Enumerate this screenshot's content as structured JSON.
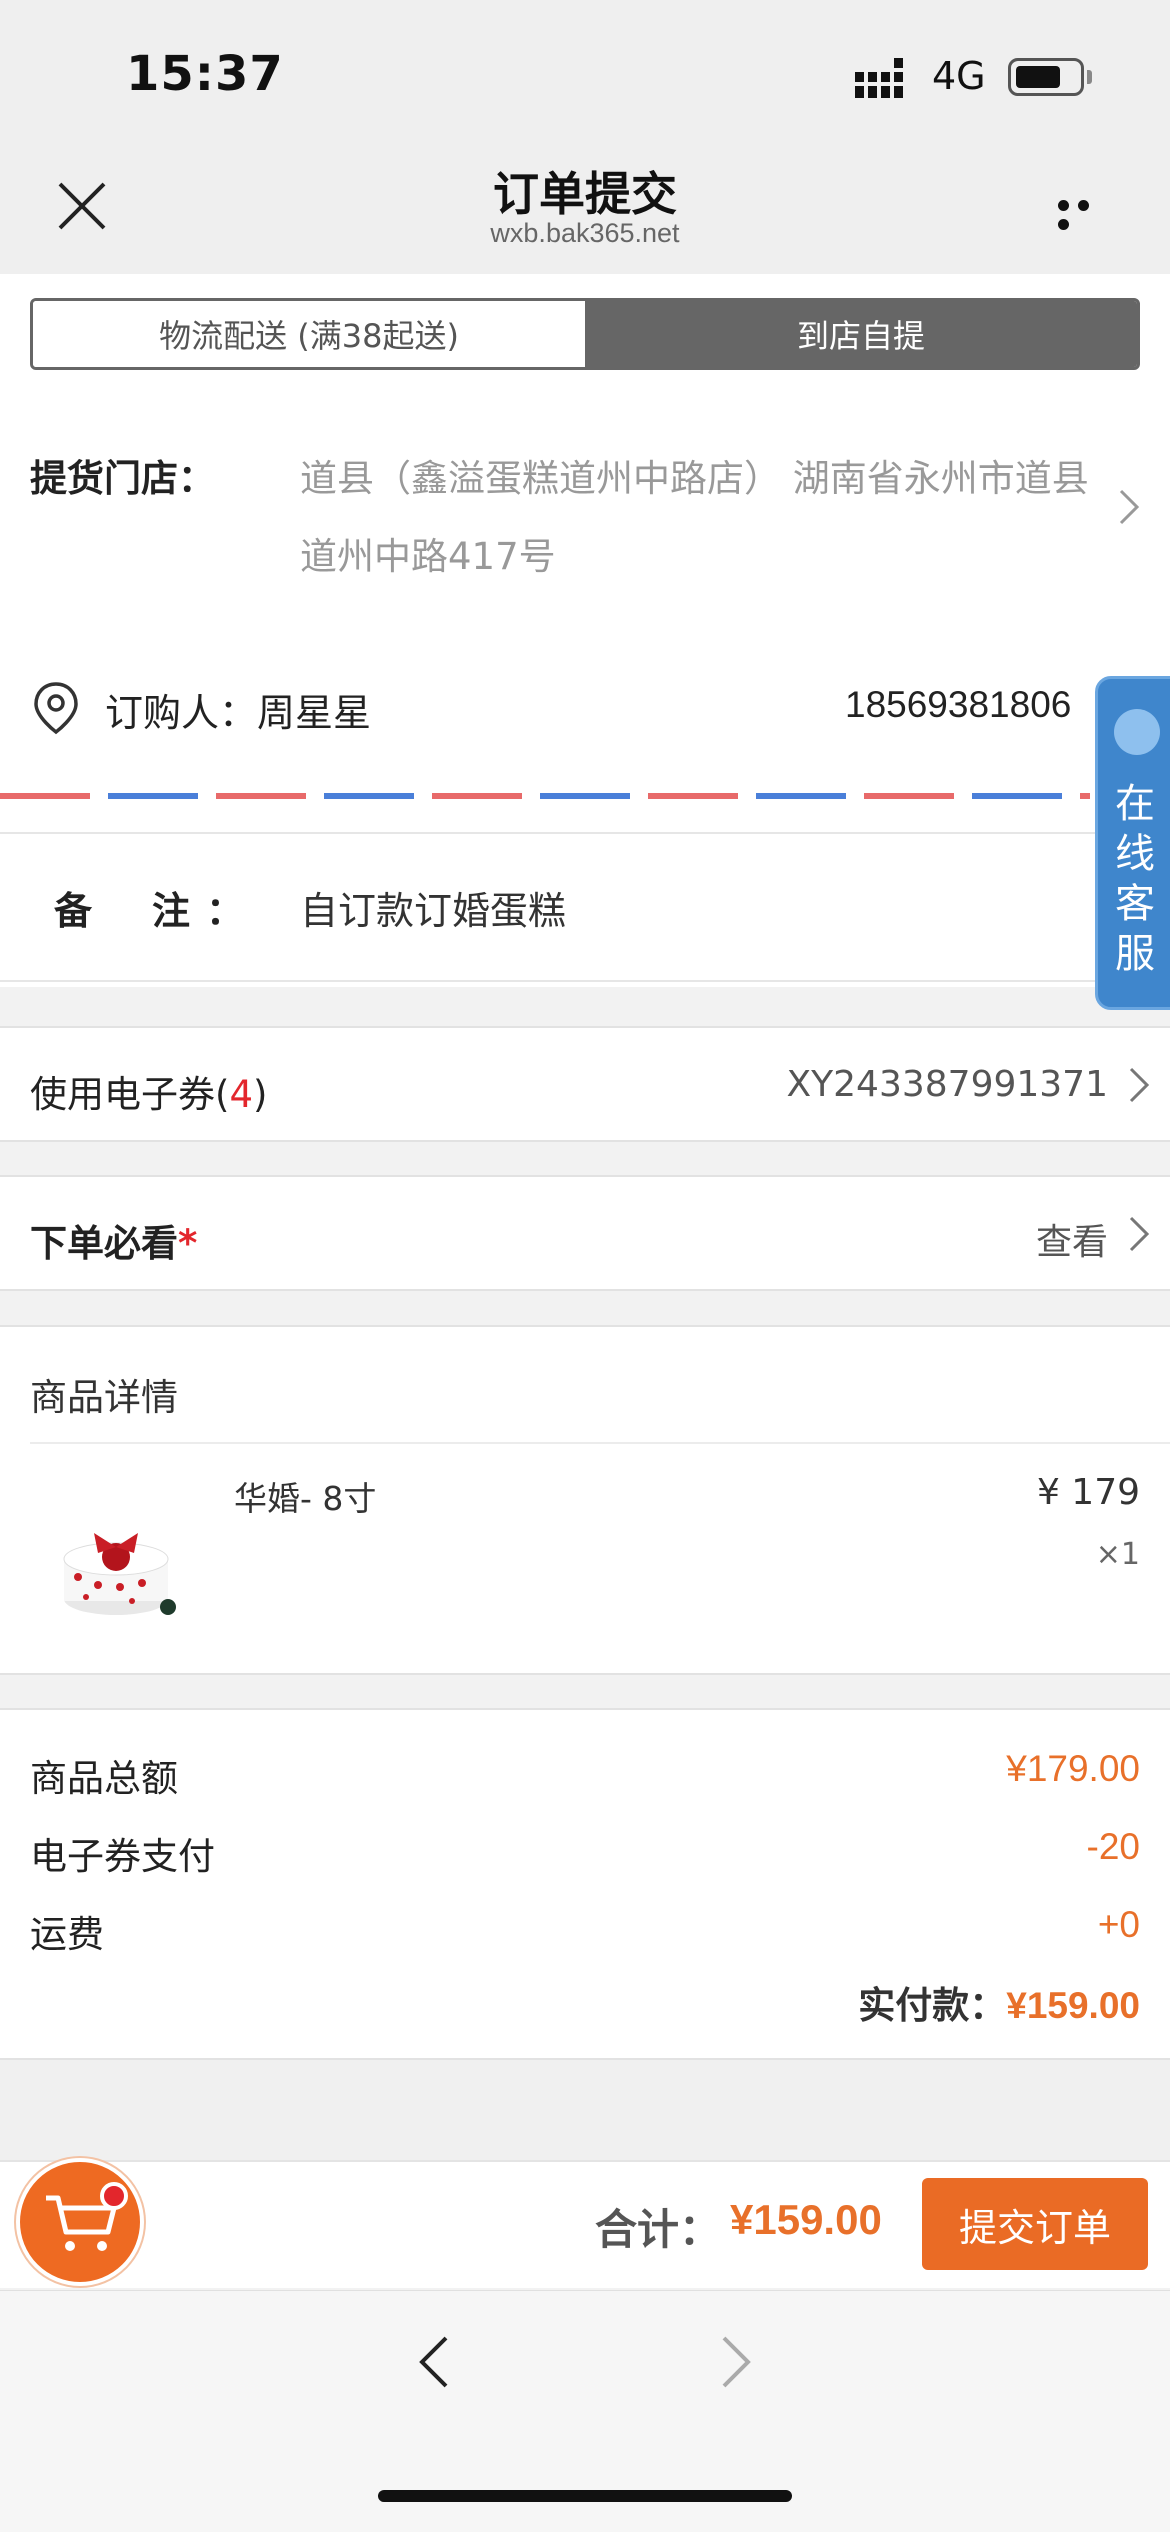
{
  "status_bar": {
    "time": "15:37",
    "network": "4G"
  },
  "nav": {
    "title": "订单提交",
    "domain": "wxb.bak365.net"
  },
  "delivery_toggle": {
    "delivery": "物流配送 (满38起送)",
    "pickup": "到店自提",
    "selected": "pickup"
  },
  "store": {
    "label": "提货门店：",
    "address": "道县（鑫溢蛋糕道州中路店） 湖南省永州市道县道州中路417号"
  },
  "buyer": {
    "label": "订购人：",
    "name": "周星星",
    "phone": "18569381806"
  },
  "remark": {
    "label": "备注",
    "colon": "：",
    "value": "自订款订婚蛋糕"
  },
  "customer_service": {
    "label": "在线客服"
  },
  "coupon": {
    "label": "使用电子券(",
    "count": "4",
    "label_end": ")",
    "value": "XY243387991371"
  },
  "must_read": {
    "label": "下单必看",
    "required_mark": "*",
    "action": "查看"
  },
  "goods": {
    "title": "商品详情",
    "items": [
      {
        "name": "华婚- 8寸",
        "price": "¥ 179",
        "qty": "×1"
      }
    ]
  },
  "totals": {
    "subtotal_label": "商品总额",
    "subtotal": "¥179.00",
    "coupon_label": "电子券支付",
    "coupon": "-20",
    "shipping_label": "运费",
    "shipping": "+0",
    "paid_label": "实付款：",
    "paid": "¥159.00"
  },
  "bottom": {
    "sum_label": "合计：",
    "sum": "¥159.00",
    "submit": "提交订单"
  },
  "colors": {
    "accent": "#e8702a",
    "toggle_active": "#666666",
    "service_tab": "#3f86cc"
  },
  "icons": [
    "close-icon",
    "more-icon",
    "location-pin-icon",
    "chevron-right-icon",
    "cart-icon",
    "back-arrow-icon",
    "forward-arrow-icon"
  ]
}
